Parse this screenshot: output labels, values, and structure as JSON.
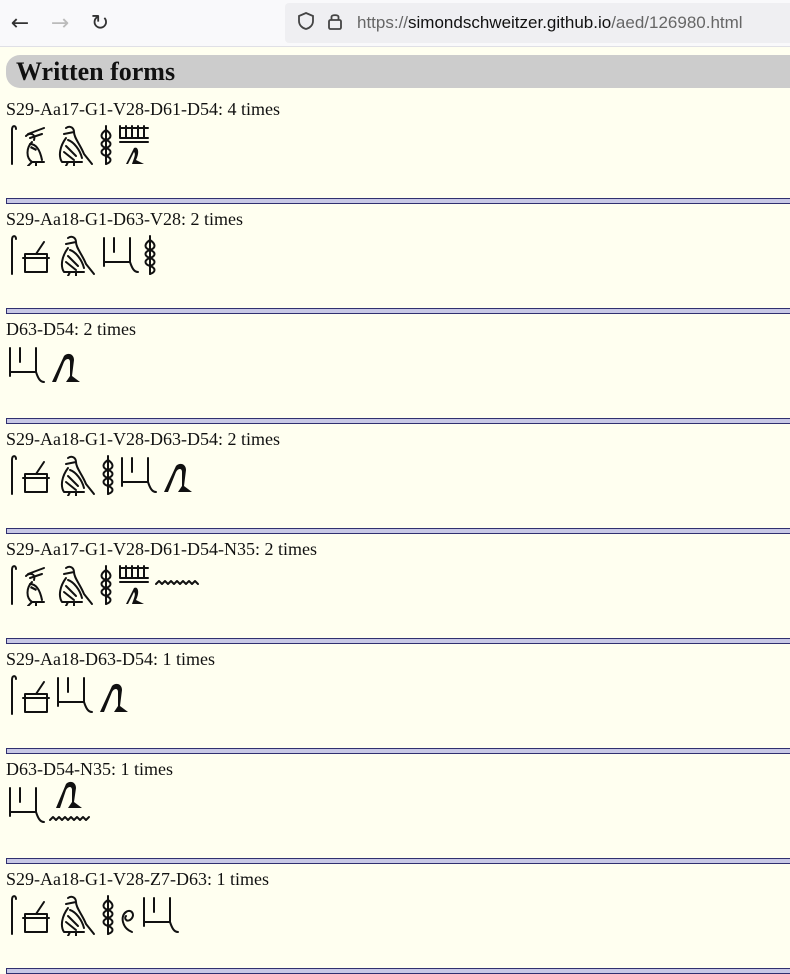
{
  "browser": {
    "back_icon": "arrow-left-icon",
    "forward_icon": "arrow-right-icon",
    "reload_icon": "reload-icon",
    "url_prefix": "https://",
    "url_host": "simondschweitzer.github.io",
    "url_path": "/aed/126980.html"
  },
  "page": {
    "heading": "Written forms"
  },
  "forms": [
    {
      "label": "S29-Aa17-G1-V28-D61-D54: 4 times",
      "signs": [
        "S29",
        "Aa17",
        "G1",
        "V28",
        "D61D54"
      ]
    },
    {
      "label": "S29-Aa18-G1-D63-V28: 2 times",
      "signs": [
        "S29",
        "Aa18",
        "G1",
        "D63",
        "V28"
      ]
    },
    {
      "label": "D63-D54: 2 times",
      "signs": [
        "D63",
        "D54"
      ]
    },
    {
      "label": "S29-Aa18-G1-V28-D63-D54: 2 times",
      "signs": [
        "S29",
        "Aa18",
        "G1",
        "V28",
        "D63",
        "D54"
      ]
    },
    {
      "label": "S29-Aa17-G1-V28-D61-D54-N35: 2 times",
      "signs": [
        "S29",
        "Aa17",
        "G1",
        "V28",
        "D61D54",
        "N35"
      ]
    },
    {
      "label": "S29-Aa18-D63-D54: 1 times",
      "signs": [
        "S29",
        "Aa18",
        "D63",
        "D54"
      ]
    },
    {
      "label": "D63-D54-N35: 1 times",
      "signs": [
        "D63",
        "D54N35"
      ]
    },
    {
      "label": "S29-Aa18-G1-V28-Z7-D63: 1 times",
      "signs": [
        "S29",
        "Aa18",
        "G1",
        "V28",
        "Z7",
        "D63"
      ]
    }
  ]
}
